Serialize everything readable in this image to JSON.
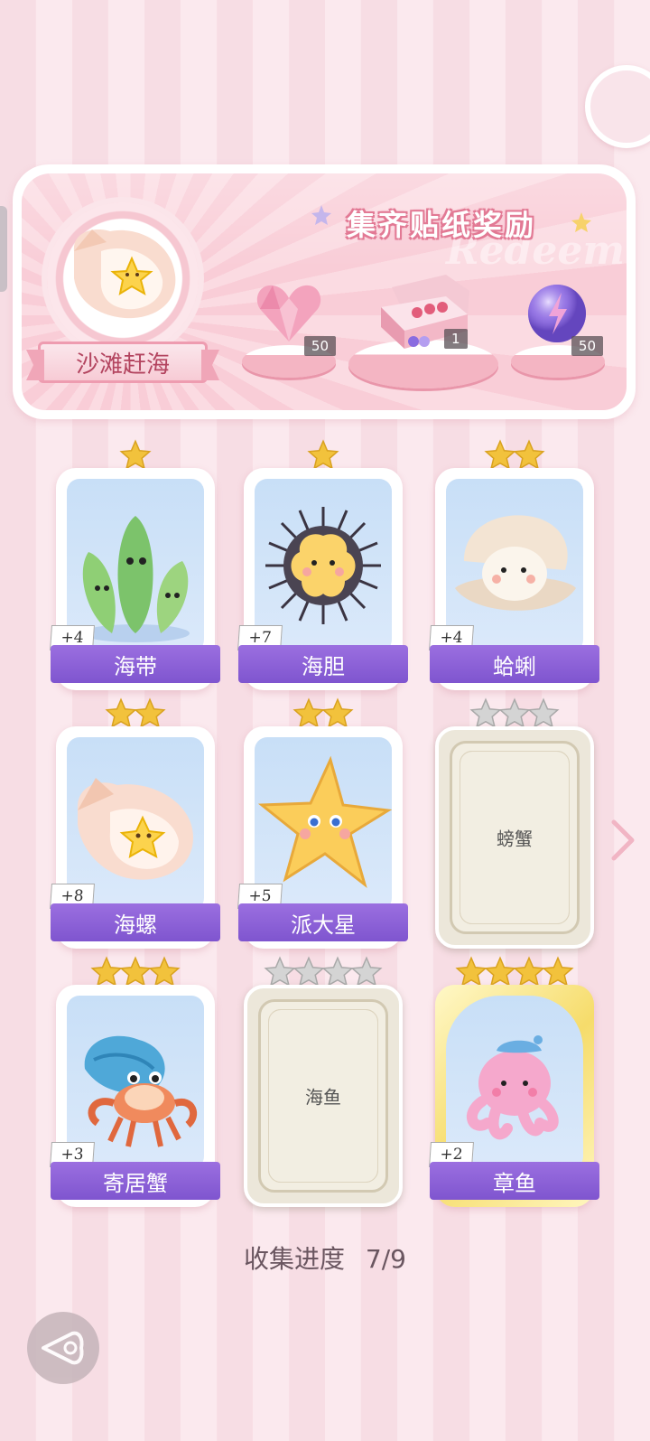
{
  "banner": {
    "title": "集齐贴纸奖励",
    "watermark": "Redeem",
    "event_name": "沙滩赶海",
    "rewards": [
      {
        "icon": "pink-heart-gem-icon",
        "count": "50"
      },
      {
        "icon": "gift-box-icon",
        "count": "1"
      },
      {
        "icon": "purple-energy-orb-icon",
        "count": "50"
      }
    ]
  },
  "cards": [
    {
      "name": "海带",
      "stars": 1,
      "count": "+4",
      "collected": true,
      "icon": "seaweed-icon"
    },
    {
      "name": "海胆",
      "stars": 1,
      "count": "+7",
      "collected": true,
      "icon": "sea-urchin-icon"
    },
    {
      "name": "蛤蜊",
      "stars": 2,
      "count": "+4",
      "collected": true,
      "icon": "clam-icon"
    },
    {
      "name": "海螺",
      "stars": 2,
      "count": "+8",
      "collected": true,
      "icon": "conch-icon"
    },
    {
      "name": "派大星",
      "stars": 2,
      "count": "+5",
      "collected": true,
      "icon": "starfish-icon"
    },
    {
      "name": "螃蟹",
      "stars": 3,
      "count": "",
      "collected": false,
      "icon": ""
    },
    {
      "name": "寄居蟹",
      "stars": 3,
      "count": "+3",
      "collected": true,
      "icon": "hermit-crab-icon"
    },
    {
      "name": "海鱼",
      "stars": 4,
      "count": "",
      "collected": false,
      "icon": ""
    },
    {
      "name": "章鱼",
      "stars": 4,
      "count": "+2",
      "collected": true,
      "icon": "octopus-icon"
    }
  ],
  "progress": {
    "label": "收集进度",
    "value": "7/9"
  },
  "colors": {
    "accent_purple": "#8a60d6",
    "star_gold": "#f2c23c",
    "star_grey": "#c9c9c9",
    "banner_pink": "#f7c6d2"
  }
}
